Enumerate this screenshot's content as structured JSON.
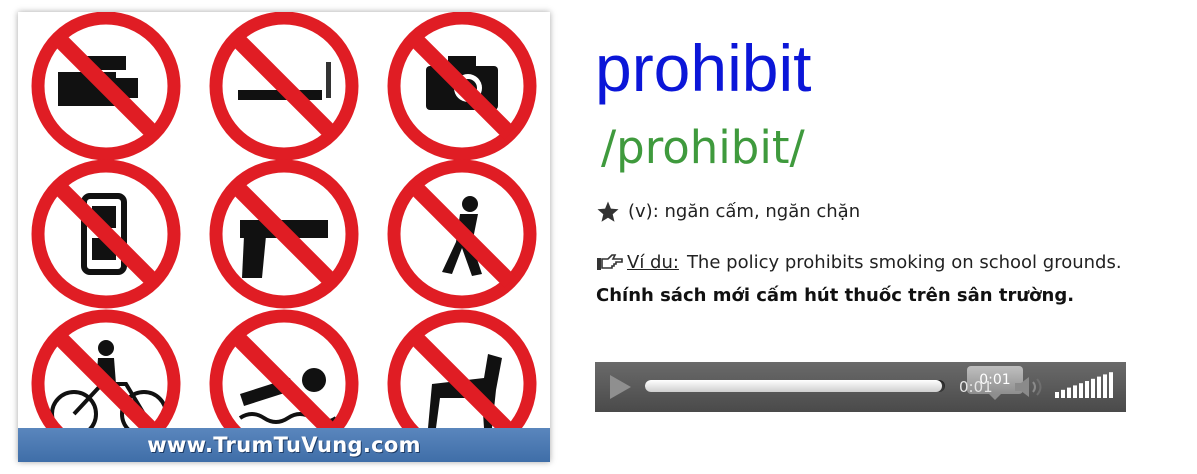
{
  "image": {
    "watermark": "www.TrumTuVung.com",
    "signs": [
      {
        "icon": "no-video-camera-icon"
      },
      {
        "icon": "no-smoking-icon"
      },
      {
        "icon": "no-camera-icon"
      },
      {
        "icon": "no-mobile-phone-icon"
      },
      {
        "icon": "no-guns-icon"
      },
      {
        "icon": "no-running-icon"
      },
      {
        "icon": "no-bicycles-icon"
      },
      {
        "icon": "no-swimming-icon"
      },
      {
        "icon": "no-dogs-icon"
      }
    ],
    "colors": {
      "sign_red": "#e01d24",
      "watermark_bar": "#4a79b3"
    }
  },
  "entry": {
    "word": "prohibit",
    "phonetic": "/prohibit/",
    "meaning": "(v): ngăn cấm, ngăn chặn",
    "example_label": "Ví du:",
    "example_text": "The policy prohibits smoking on school grounds.",
    "translation": "Chính sách mới cấm hút thuốc trên sân trường.",
    "colors": {
      "word": "#0b16d8",
      "phonetic": "#3f9a3d"
    }
  },
  "audio": {
    "tooltip_time": "0:01",
    "current_time": "0:01",
    "progress": 0.99,
    "volume_level": 1.0,
    "icons": {
      "play": "play-icon",
      "volume": "speaker-icon",
      "bars": "volume-bars-icon"
    }
  }
}
